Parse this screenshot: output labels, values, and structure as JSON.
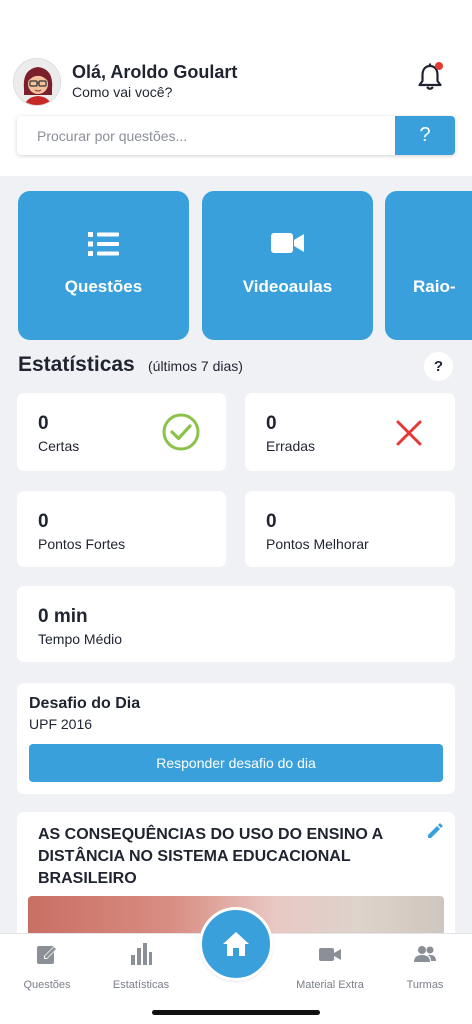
{
  "header": {
    "greeting": "Olá, Aroldo Goulart",
    "subtitle": "Como vai você?"
  },
  "search": {
    "placeholder": "Procurar por questões...",
    "help_label": "?"
  },
  "tiles": [
    {
      "label": "Questões",
      "icon": "list-icon"
    },
    {
      "label": "Videoaulas",
      "icon": "video-camera-icon"
    },
    {
      "label": "Raio-",
      "icon": ""
    }
  ],
  "stats": {
    "title": "Estatísticas",
    "subtitle": "(últimos 7 dias)",
    "help_label": "?",
    "certas": {
      "value": "0",
      "label": "Certas"
    },
    "erradas": {
      "value": "0",
      "label": "Erradas"
    },
    "fortes": {
      "value": "0",
      "label": "Pontos Fortes"
    },
    "melhorar": {
      "value": "0",
      "label": "Pontos Melhorar"
    },
    "tempo": {
      "value": "0 min",
      "label": "Tempo Médio"
    }
  },
  "desafio": {
    "title": "Desafio do Dia",
    "subtitle": "UPF 2016",
    "button_label": "Responder desafio do dia"
  },
  "article": {
    "title": "AS CONSEQUÊNCIAS DO USO DO ENSINO A DISTÂNCIA NO SISTEMA EDUCACIONAL BRASILEIRO"
  },
  "tabbar": {
    "questoes": "Questões",
    "estatisticas": "Estatísticas",
    "material": "Material Extra",
    "turmas": "Turmas"
  },
  "colors": {
    "accent": "#3aa0dc",
    "success": "#8bc34a",
    "error": "#e53935",
    "background": "#f0f1f5"
  }
}
